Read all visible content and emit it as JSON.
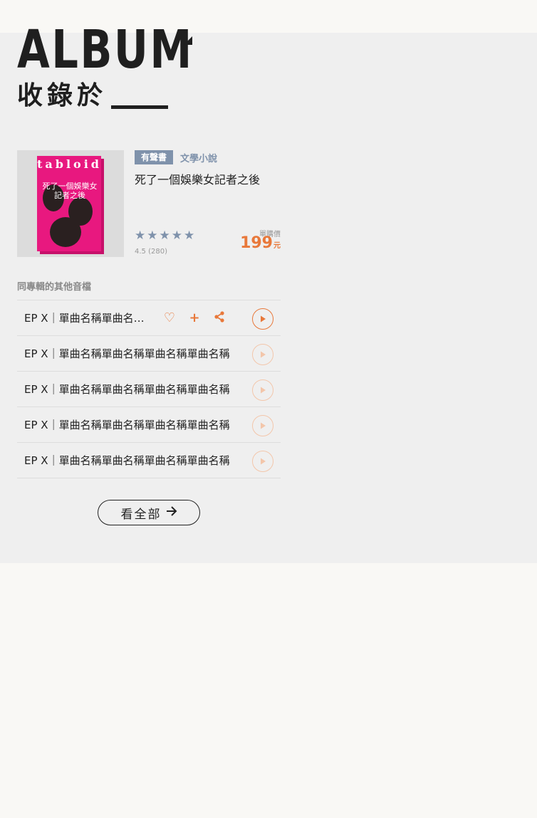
{
  "header": {
    "title": "ALBUM",
    "subtitle": "收錄於"
  },
  "book": {
    "cover_brand": "tabloid",
    "cover_title": "死了一個娛樂女記者之後",
    "tag_audio": "有聲書",
    "category": "文學小說",
    "title": "死了一個娛樂女記者之後",
    "stars": 5,
    "rating": "4.5 (280)",
    "price_label": "單購價",
    "price": "199",
    "price_unit": "元"
  },
  "tracks": {
    "heading": "同專輯的其他音檔",
    "items": [
      {
        "label": "EP X｜單曲名稱單曲名稱單曲名稱單曲名稱單曲名稱"
      },
      {
        "label": "EP X｜單曲名稱單曲名稱單曲名稱單曲名稱"
      },
      {
        "label": "EP X｜單曲名稱單曲名稱單曲名稱單曲名稱"
      },
      {
        "label": "EP X｜單曲名稱單曲名稱單曲名稱單曲名稱"
      },
      {
        "label": "EP X｜單曲名稱單曲名稱單曲名稱單曲名稱"
      }
    ]
  },
  "view_all": {
    "label": "看全部"
  },
  "colors": {
    "accent": "#e8783a",
    "tag": "#7f92ab",
    "text": "#1f1f1f",
    "panel": "#efefef"
  },
  "icons": {
    "like": "heart-icon",
    "add": "plus-icon",
    "share": "share-icon",
    "play": "play-icon",
    "arrow": "arrow-right-icon"
  }
}
